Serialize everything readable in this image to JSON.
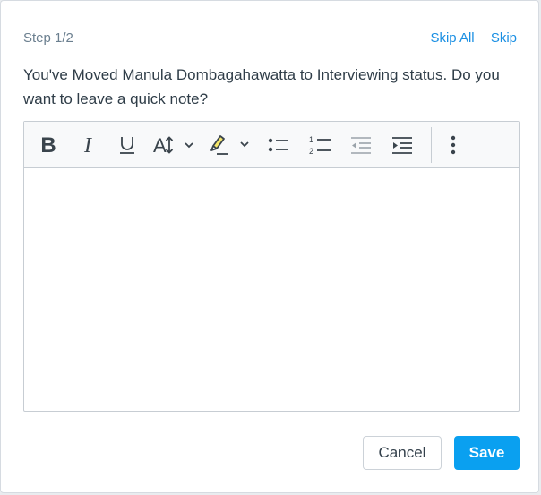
{
  "dialog": {
    "step_label": "Step 1/2",
    "skip_all_label": "Skip All",
    "skip_label": "Skip",
    "message": "You've Moved Manula Dombagahawatta to Interviewing status. Do you want to leave a quick note?"
  },
  "toolbar": {
    "buttons": [
      {
        "name": "bold",
        "icon": "bold-icon"
      },
      {
        "name": "italic",
        "icon": "italic-icon"
      },
      {
        "name": "underline",
        "icon": "underline-icon"
      },
      {
        "name": "font-size",
        "icon": "font-size-icon"
      },
      {
        "name": "highlight",
        "icon": "highlight-marker-icon"
      },
      {
        "name": "bulleted-list",
        "icon": "bulleted-list-icon"
      },
      {
        "name": "numbered-list",
        "icon": "numbered-list-icon"
      },
      {
        "name": "outdent",
        "icon": "outdent-icon"
      },
      {
        "name": "indent",
        "icon": "indent-icon"
      },
      {
        "name": "more",
        "icon": "more-vertical-icon"
      }
    ],
    "highlight_color": "#f5e66a"
  },
  "editor": {
    "content": ""
  },
  "actions": {
    "cancel_label": "Cancel",
    "save_label": "Save"
  },
  "colors": {
    "accent": "#0aa0f0",
    "link": "#1a8fe3",
    "text": "#2f3d48",
    "muted": "#6b7f8f"
  }
}
